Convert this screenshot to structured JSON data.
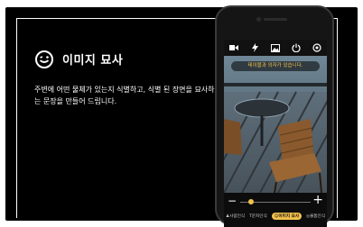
{
  "feature": {
    "title": "이미지 묘사",
    "description": "주변에 어떤 물체가 있는지 식별하고, 식별 된 장면을 묘사하는 문장을 만들어 드립니다.",
    "icon": "smile-face-icon"
  },
  "phone": {
    "toolbar_icons": [
      "video-icon",
      "flash-icon",
      "gallery-icon",
      "power-icon",
      "settings-icon"
    ],
    "caption": "테이블과 의자가 있습니다.",
    "zoom": {
      "minus": "−",
      "plus": "+",
      "level": 0.15
    },
    "modes": [
      {
        "label": "사람인식",
        "icon": "person-icon"
      },
      {
        "label": "문자인식",
        "icon": "text-icon"
      },
      {
        "label": "이미지 묘사",
        "icon": "smile-face-icon",
        "active": true
      },
      {
        "label": "물품인식",
        "icon": "object-icon"
      }
    ],
    "accent_color": "#f3c14b"
  }
}
